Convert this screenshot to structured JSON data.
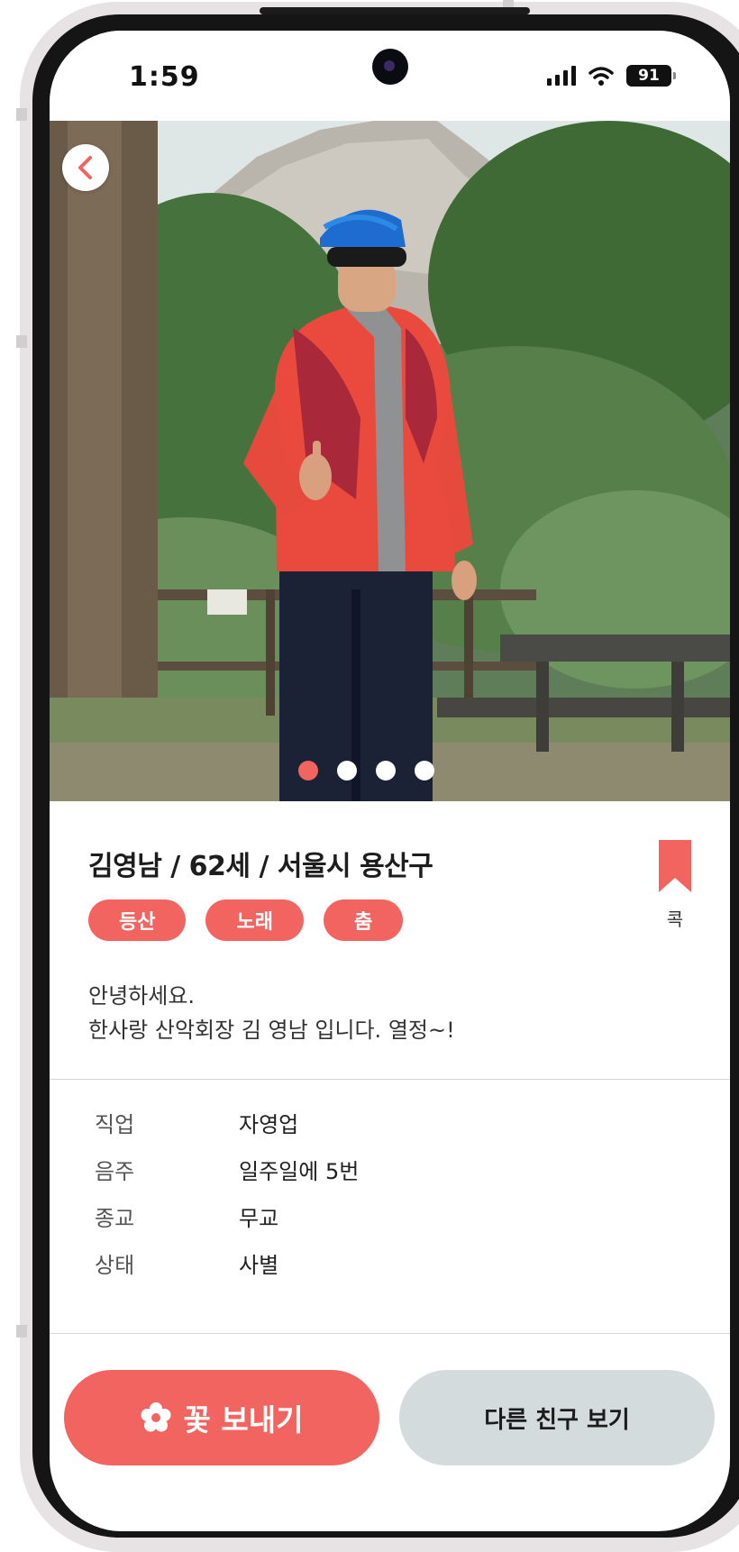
{
  "status_bar": {
    "time": "1:59",
    "battery": "91"
  },
  "photo": {
    "subject": "hiker-portrait",
    "pages_total": 4,
    "page_active": 1
  },
  "profile": {
    "title": "김영남 / 62세 / 서울시 용산구",
    "bookmark_label": "콕",
    "tags": [
      "등산",
      "노래",
      "춤"
    ],
    "intro": [
      "안녕하세요.",
      "한사랑 산악회장 김 영남 입니다. 열정~!"
    ],
    "details": [
      {
        "label": "직업",
        "value": "자영업"
      },
      {
        "label": "음주",
        "value": "일주일에 5번"
      },
      {
        "label": "종교",
        "value": "무교"
      },
      {
        "label": "상태",
        "value": "사별"
      }
    ]
  },
  "actions": {
    "send_flower": "꽃 보내기",
    "other_friend": "다른 친구 보기"
  },
  "colors": {
    "accent": "#f2645f",
    "secondary_button": "#d4dbdd",
    "text": "#1d1d1d"
  },
  "icons": [
    "back-chevron-icon",
    "bookmark-icon",
    "flower-icon",
    "signal-icon",
    "wifi-icon",
    "battery-icon"
  ]
}
